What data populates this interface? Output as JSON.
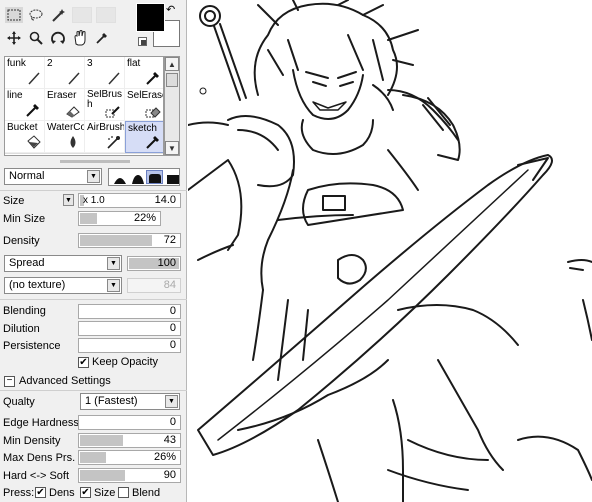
{
  "toolbar": {
    "tools_row1": [
      "rect-select",
      "lasso",
      "magic-wand"
    ],
    "tools_row2": [
      "move",
      "zoom",
      "rotate",
      "hand",
      "eyedropper"
    ]
  },
  "colors": {
    "foreground": "#000000",
    "background": "#ffffff",
    "accent": "#d6ddf6"
  },
  "brushes": {
    "row1": [
      "funk",
      "2",
      "3",
      "flat"
    ],
    "row2": [
      "line",
      "Eraser",
      "SelBrush",
      "SelErase"
    ],
    "row3": [
      "Bucket",
      "WaterCo",
      "AirBrush",
      "sketch"
    ],
    "selected": "sketch"
  },
  "blend_mode": {
    "value": "Normal"
  },
  "size": {
    "label": "Size",
    "multiplier": "x 1.0",
    "value": "14.0"
  },
  "min_size": {
    "label": "Min Size",
    "value": "22%"
  },
  "density": {
    "label": "Density",
    "value": "72"
  },
  "spread": {
    "select": "Spread",
    "value": "100"
  },
  "texture": {
    "select": "(no texture)",
    "value": "84"
  },
  "blending": {
    "label": "Blending",
    "value": "0"
  },
  "dilution": {
    "label": "Dilution",
    "value": "0"
  },
  "persistence": {
    "label": "Persistence",
    "value": "0"
  },
  "keep_opacity": {
    "label": "Keep Opacity",
    "checked": true
  },
  "advanced": {
    "toggle": "−",
    "title": "Advanced Settings",
    "quality_label": "Qualty",
    "quality_value": "1 (Fastest)",
    "edge_hardness_label": "Edge Hardness",
    "edge_hardness_value": "0",
    "min_density_label": "Min Density",
    "min_density_value": "43",
    "max_dens_label": "Max Dens Prs.",
    "max_dens_value": "26%",
    "hard_soft_label": "Hard <-> Soft",
    "hard_soft_value": "90"
  },
  "press": {
    "label": "Press:",
    "dens": "Dens",
    "size": "Size",
    "blend": "Blend"
  }
}
